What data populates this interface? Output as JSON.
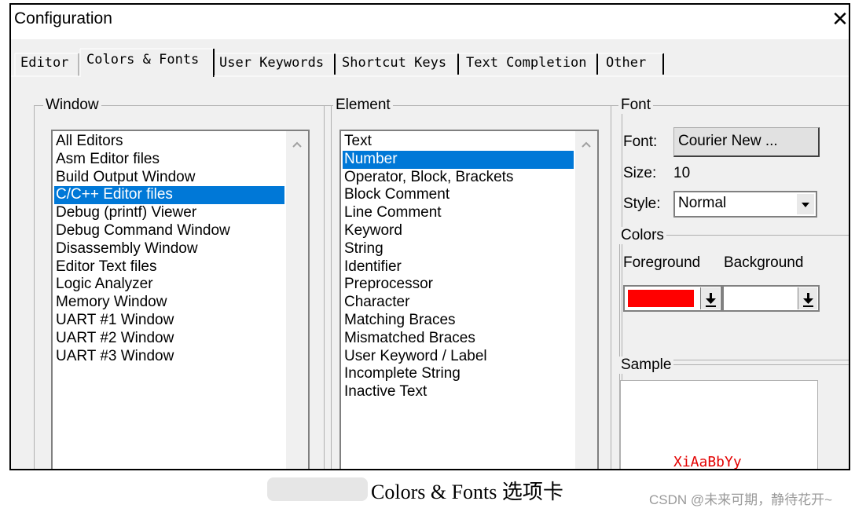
{
  "window": {
    "title": "Configuration",
    "close_glyph": "✕"
  },
  "tabs": [
    {
      "label": "Editor",
      "active": false
    },
    {
      "label": "Colors & Fonts",
      "active": true
    },
    {
      "label": "User Keywords",
      "active": false
    },
    {
      "label": "Shortcut Keys",
      "active": false
    },
    {
      "label": "Text Completion",
      "active": false
    },
    {
      "label": "Other",
      "active": false
    }
  ],
  "window_group": {
    "label": "Window",
    "items": [
      "All Editors",
      "Asm Editor files",
      "Build Output Window",
      "C/C++ Editor files",
      "Debug (printf) Viewer",
      "Debug Command Window",
      "Disassembly Window",
      "Editor Text files",
      "Logic Analyzer",
      "Memory Window",
      "UART #1 Window",
      "UART #2 Window",
      "UART #3 Window"
    ],
    "selected": "C/C++ Editor files"
  },
  "element_group": {
    "label": "Element",
    "items": [
      "Text",
      "Number",
      "Operator, Block, Brackets",
      "Block Comment",
      "Line Comment",
      "Keyword",
      "String",
      "Identifier",
      "Preprocessor",
      "Character",
      "Matching Braces",
      "Mismatched Braces",
      "User Keyword / Label",
      "Incomplete String",
      "Inactive Text"
    ],
    "selected": "Number"
  },
  "font_group": {
    "label": "Font",
    "font_label": "Font:",
    "font_button": "Courier New ...",
    "size_label": "Size:",
    "size_value": "10",
    "style_label": "Style:",
    "style_value": "Normal"
  },
  "colors_group": {
    "label": "Colors",
    "foreground_label": "Foreground",
    "background_label": "Background",
    "foreground_color": "#ff0000",
    "background_color": "#ffffff"
  },
  "sample_group": {
    "label": "Sample",
    "sample_text": "XiAaBbYy",
    "sample_color": "#e30000"
  },
  "caption": "Colors & Fonts 选项卡",
  "watermark": "CSDN @未来可期，静待花开~"
}
